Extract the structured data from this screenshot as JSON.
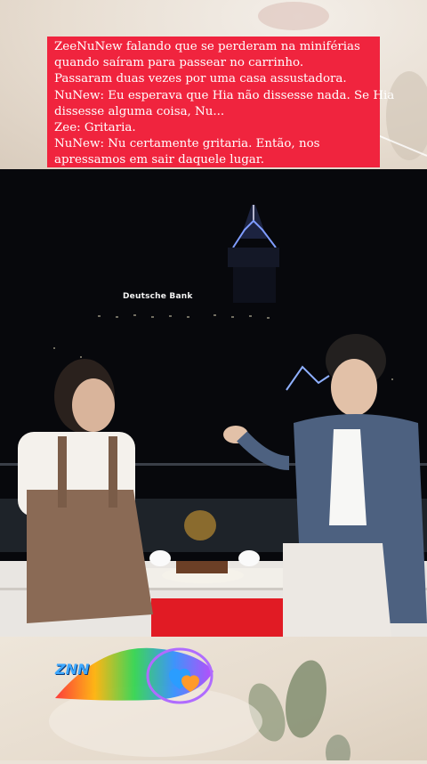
{
  "caption": {
    "lines": [
      "ZeeNuNew falando que se perderam na miniférias",
      "quando saíram para passear no carrinho.",
      "Passaram duas vezes por uma casa assustadora.",
      "NuNew: Eu esperava que Hia não dissesse nada. Se Hia",
      "dissesse alguma coisa, Nu...",
      "Zee: Gritaria.",
      "NuNew: Nu certamente gritaria. Então, nos",
      "apressamos em sair daquele lugar."
    ]
  },
  "video": {
    "building_sign": "Deutsche Bank"
  },
  "logo": {
    "text": "ZNN"
  },
  "colors": {
    "caption_bg": "#f0243e",
    "video_bg": "#07080c"
  }
}
